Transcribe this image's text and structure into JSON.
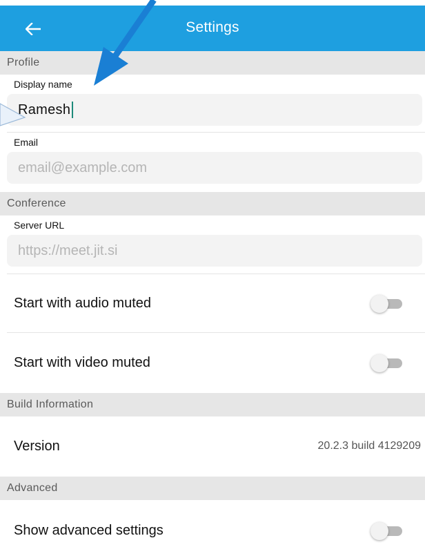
{
  "header": {
    "title": "Settings",
    "back_icon": "arrow-left-icon",
    "color": "#1e9fe0"
  },
  "profile": {
    "section_title": "Profile",
    "display_name_label": "Display name",
    "display_name_value": "Ramesh",
    "email_label": "Email",
    "email_placeholder": "email@example.com"
  },
  "conference": {
    "section_title": "Conference",
    "server_url_label": "Server URL",
    "server_url_placeholder": "https://meet.jit.si",
    "audio_muted_label": "Start with audio muted",
    "audio_muted_on": false,
    "video_muted_label": "Start with video muted",
    "video_muted_on": false
  },
  "build": {
    "section_title": "Build Information",
    "version_label": "Version",
    "version_value": "20.2.3 build 4129209"
  },
  "advanced": {
    "section_title": "Advanced",
    "show_advanced_label": "Show advanced settings",
    "show_advanced_on": false
  },
  "annotation": {
    "arrow_color": "#1a7fd4",
    "callout_color": "#9ab8d8"
  }
}
